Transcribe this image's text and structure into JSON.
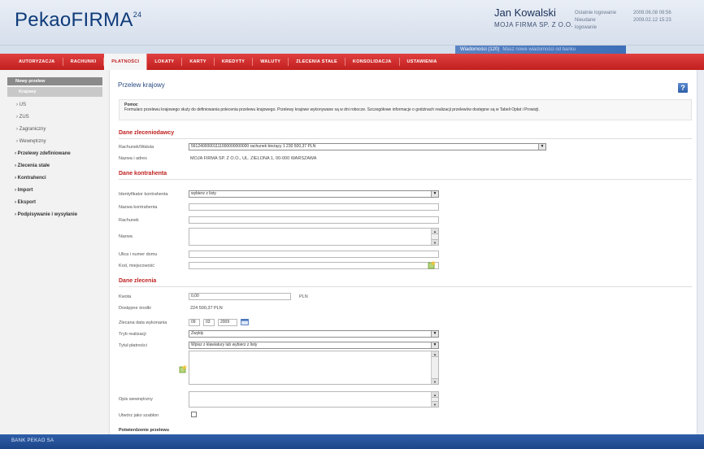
{
  "header": {
    "logo": "PekaoFIRMA",
    "logo_mark": "24",
    "user_name": "Jan Kowalski",
    "company": "MOJA FIRMA SP. Z O.O.",
    "last_login_label": "Ostatnie logowanie",
    "last_login_value": "2009.06.08 09:56",
    "failed_login_label": "Nieudane logowanie",
    "failed_login_value": "2009.02.12 15:23",
    "messages_label": "Wiadomości (120)",
    "messages_sub": "Masz nowe wiadomości od banku"
  },
  "topnav": [
    {
      "label": "AUTORYZACJA"
    },
    {
      "label": "RACHUNKI"
    },
    {
      "label": "PŁATNOŚCI"
    },
    {
      "label": "LOKATY"
    },
    {
      "label": "KARTY"
    },
    {
      "label": "KREDYTY"
    },
    {
      "label": "WALUTY"
    },
    {
      "label": "ZLECENIA STAŁE"
    },
    {
      "label": "KONSOLIDACJA"
    },
    {
      "label": "USTAWIENIA"
    }
  ],
  "sidebar": {
    "head": "Nowy przelew",
    "active": "Krajowy",
    "subitems": [
      "US",
      "ZUS",
      "Zagraniczny",
      "Wewnętrzny"
    ],
    "main_items": [
      "Przelewy zdefiniowane",
      "Zlecenia stałe",
      "Kontrahenci",
      "Import",
      "Eksport",
      "Podpisywanie i wysyłanie"
    ]
  },
  "main": {
    "title": "Przelew krajowy",
    "help": "?",
    "notice_title": "Pomoc",
    "notice_text": "Formularz przelewu krajowego służy do definiowania polecenia przelewu krajowego. Przelewy krajowe wykonywane są w dni robocze. Szczegółowe informacje o godzinach realizacji przelewów dostępne są w Tabeli Opłat i Prowizji.",
    "section1": "Dane zleceniodawcy",
    "account_label": "Rachunek/Waluta",
    "account_value": "56124000001111000000000000 rachunek bieżący 1 230 500,37 PLN",
    "name_label": "Nazwa i adres",
    "name_value": "MOJA FIRMA SP. Z O.O., UL. ZIELONA 1, 00-000 WARSZAWA",
    "section2": "Dane kontrahenta",
    "contractor_id_label": "Identyfikator kontrahenta",
    "contractor_id_value": "wybierz z listy",
    "contractor_name_label": "Nazwa kontrahenta",
    "account2_label": "Rachunek",
    "name2_label": "Nazwa",
    "street_label": "Ulica i numer domu",
    "city_label": "Kod, miejscowość",
    "section3": "Dane zlecenia",
    "amount_label": "Kwota",
    "amount_value": "0,00",
    "currency": "PLN",
    "available_label": "Dostępne środki",
    "available_value": "224 500,37 PLN",
    "date_label": "Zlecana data wykonania",
    "date_dd": "09",
    "date_mm": "03",
    "date_yyyy": "2009",
    "mode_label": "Tryb realizacji",
    "mode_value": "Zwykły",
    "title_label": "Tytuł płatności",
    "title_value": "Wpisz z klawiatury lub wybierz z listy",
    "own_ref_label": "Opis wewnętrzny",
    "template_label": "Utwórz jako szablon",
    "confirm_label": "Potwierdzenie przelewu"
  },
  "footer": {
    "text": "BANK PEKAO SA"
  },
  "colors": {
    "nav_red": "#c21f1f",
    "footer_blue": "#1d4689",
    "section_red": "#c02020"
  }
}
